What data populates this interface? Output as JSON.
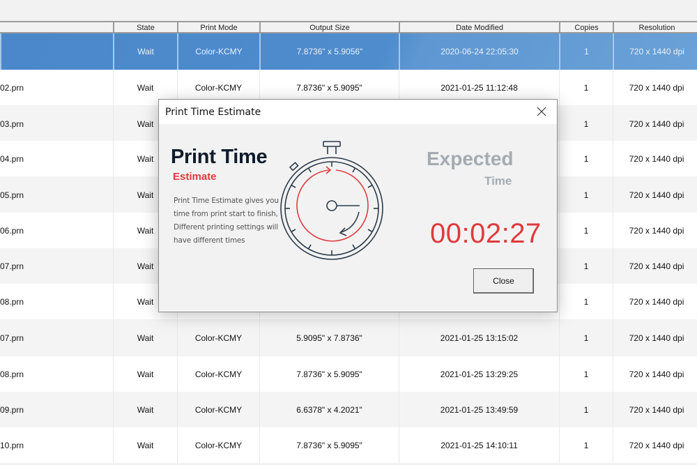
{
  "table": {
    "columns": {
      "state": "State",
      "print_mode": "Print Mode",
      "output_size": "Output Size",
      "date_modified": "Date Modified",
      "copies": "Copies",
      "resolution": "Resolution"
    },
    "rows": [
      {
        "name": "",
        "state": "Wait",
        "mode": "Color-KCMY",
        "size": "7.8736\" x 5.9056\"",
        "date": "2020-06-24 22:05:30",
        "copies": "1",
        "res": "720 x 1440 dpi",
        "selected": true
      },
      {
        "name": "02.prn",
        "state": "Wait",
        "mode": "Color-KCMY",
        "size": "7.8736\" x 5.9095\"",
        "date": "2021-01-25 11:12:48",
        "copies": "1",
        "res": "720 x 1440 dpi"
      },
      {
        "name": "03.prn",
        "state": "Wait",
        "mode": "",
        "size": "",
        "date": "",
        "copies": "1",
        "res": "720 x 1440 dpi"
      },
      {
        "name": "04.prn",
        "state": "Wait",
        "mode": "",
        "size": "",
        "date": "",
        "copies": "1",
        "res": "720 x 1440 dpi"
      },
      {
        "name": "05.prn",
        "state": "Wait",
        "mode": "",
        "size": "",
        "date": "",
        "copies": "1",
        "res": "720 x 1440 dpi"
      },
      {
        "name": "06.prn",
        "state": "Wait",
        "mode": "",
        "size": "",
        "date": "",
        "copies": "1",
        "res": "720 x 1440 dpi"
      },
      {
        "name": "07.prn",
        "state": "Wait",
        "mode": "",
        "size": "",
        "date": "",
        "copies": "1",
        "res": "720 x 1440 dpi"
      },
      {
        "name": "08.prn",
        "state": "Wait",
        "mode": "",
        "size": "",
        "date": "",
        "copies": "1",
        "res": "720 x 1440 dpi"
      },
      {
        "name": "07.prn",
        "state": "Wait",
        "mode": "Color-KCMY",
        "size": "5.9095\" x 7.8736\"",
        "date": "2021-01-25 13:15:02",
        "copies": "1",
        "res": "720 x 1440 dpi"
      },
      {
        "name": "08.prn",
        "state": "Wait",
        "mode": "Color-KCMY",
        "size": "7.8736\" x 5.9095\"",
        "date": "2021-01-25 13:29:25",
        "copies": "1",
        "res": "720 x 1440 dpi"
      },
      {
        "name": "09.prn",
        "state": "Wait",
        "mode": "Color-KCMY",
        "size": "6.6378\" x 4.2021\"",
        "date": "2021-01-25 13:49:59",
        "copies": "1",
        "res": "720 x 1440 dpi"
      },
      {
        "name": "10.prn",
        "state": "Wait",
        "mode": "Color-KCMY",
        "size": "7.8736\" x 5.9095\"",
        "date": "2021-01-25 14:10:11",
        "copies": "1",
        "res": "720 x 1440 dpi"
      }
    ]
  },
  "dialog": {
    "title": "Print Time Estimate",
    "close_icon": "close-x-icon",
    "hero_title": "Print Time",
    "hero_subtitle": "Estimate",
    "description": "Print Time Estimate gives you time from print start to finish, Different printing settings will have different times",
    "illustration": "stopwatch-icon",
    "expected_title": "Expected",
    "expected_subtitle": "Time",
    "time_value": "00:02:27",
    "close_button": "Close",
    "colors": {
      "accent_red": "#e03a3e",
      "heading_dark": "#101c2c",
      "muted_gray": "#a4abb1"
    }
  },
  "colors": {
    "selected_row": "#4e8ccd"
  }
}
